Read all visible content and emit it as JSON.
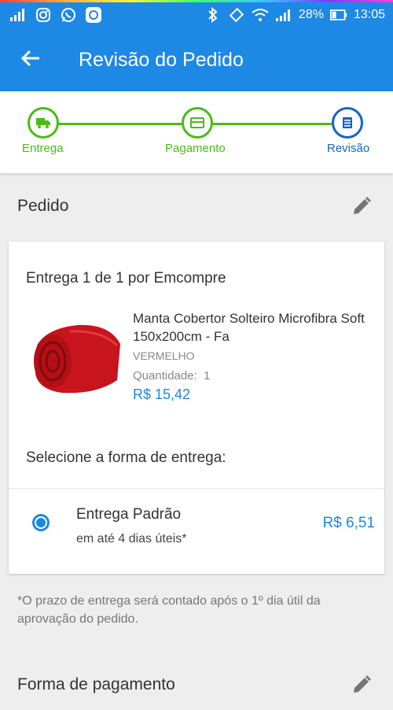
{
  "status_bar": {
    "battery_percent": "28%",
    "time": "13:05"
  },
  "app_bar": {
    "title": "Revisão do Pedido"
  },
  "stepper": {
    "steps": [
      {
        "label": "Entrega"
      },
      {
        "label": "Pagamento"
      },
      {
        "label": "Revisão"
      }
    ]
  },
  "order_section": {
    "title": "Pedido"
  },
  "delivery_card": {
    "title": "Entrega 1 de 1 por Emcompre",
    "product": {
      "name": "Manta Cobertor Solteiro Microfibra Soft 150x200cm - Fa",
      "color": "VERMELHO",
      "quantity_label": "Quantidade:",
      "quantity_value": "1",
      "price": "R$ 15,42"
    },
    "shipping_prompt": "Selecione a forma de entrega:",
    "shipping_option": {
      "name": "Entrega Padrão",
      "time": "em até 4 dias úteis*",
      "price": "R$ 6,51",
      "selected": true
    }
  },
  "note": "*O prazo de entrega será contado após o 1º dia útil da aprovação do pedido.",
  "payment_section": {
    "title": "Forma de pagamento"
  },
  "colors": {
    "primary": "#1e88e5",
    "step_done": "#4cbb17",
    "step_current": "#1565c0"
  }
}
